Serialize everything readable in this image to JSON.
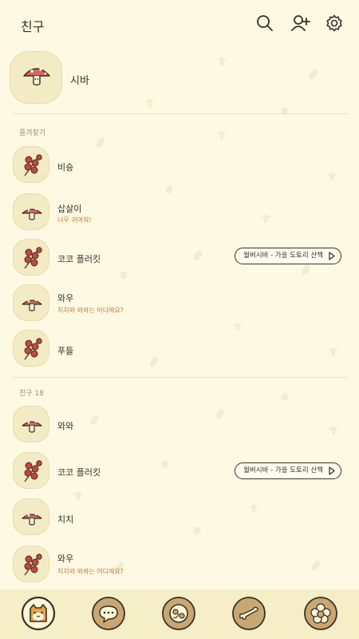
{
  "header": {
    "title": "친구",
    "icons": [
      "search-icon",
      "add-friend-icon",
      "settings-icon"
    ]
  },
  "profile": {
    "name": "시바"
  },
  "favorites": {
    "label": "즐겨찾기",
    "items": [
      {
        "name": "비숑",
        "status": "",
        "music": "",
        "avatar": "berry"
      },
      {
        "name": "삽살이",
        "status": "너무 귀여워!",
        "music": "",
        "avatar": "mushroom"
      },
      {
        "name": "코코 플러킷",
        "status": "",
        "music": "월버시바 - 가을 도토리 산책",
        "avatar": "berry"
      },
      {
        "name": "와우",
        "status": "치치와 와와는 어디에요?",
        "music": "",
        "avatar": "mushroom"
      },
      {
        "name": "푸들",
        "status": "",
        "music": "",
        "avatar": "berry"
      }
    ]
  },
  "friends": {
    "label": "친구 18",
    "items": [
      {
        "name": "와와",
        "status": "",
        "music": "",
        "avatar": "mushroom"
      },
      {
        "name": "코코 플러킷",
        "status": "",
        "music": "월버시바 - 가을 도토리 산책",
        "avatar": "berry"
      },
      {
        "name": "치치",
        "status": "",
        "music": "",
        "avatar": "mushroom"
      },
      {
        "name": "와우",
        "status": "치치와 와와는 어디에요?",
        "music": "",
        "avatar": "berry"
      }
    ]
  },
  "tabs": [
    "friends-tab-icon",
    "chat-tab-icon",
    "openchat-tab-icon",
    "shopping-tab-icon",
    "more-tab-icon"
  ],
  "colors": {
    "background": "#fdf9e3",
    "tabbar": "#f5eec7",
    "accent": "#c9763a",
    "mushroom": "#d9655e",
    "berry": "#c8453f"
  }
}
